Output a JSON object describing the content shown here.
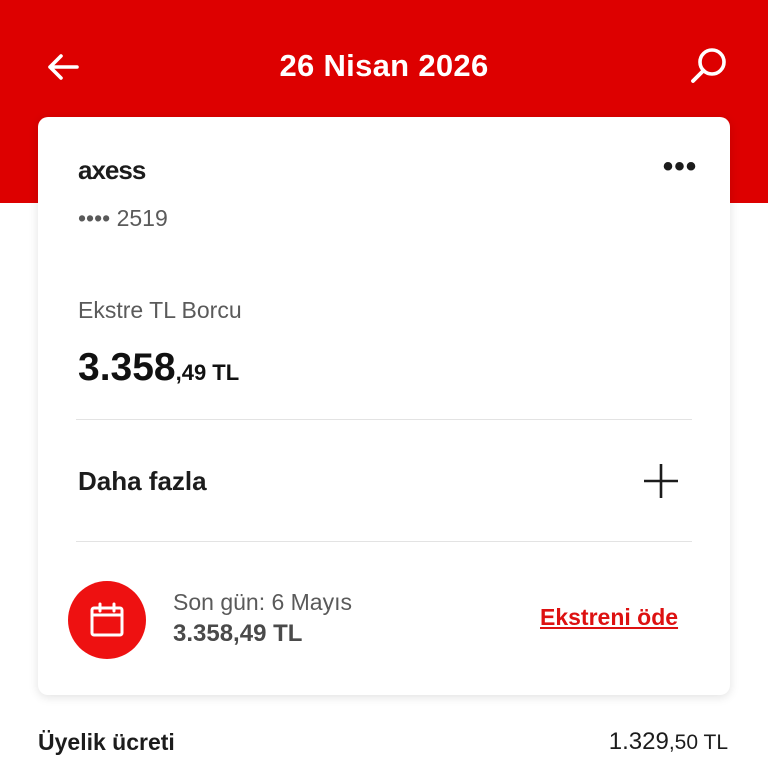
{
  "header": {
    "title": "26 Nisan 2026",
    "back_icon": "arrow-left-icon",
    "search_icon": "search-icon",
    "background_color": "#dd0000"
  },
  "card": {
    "brand": "axess",
    "more_icon": "more-horizontal-icon",
    "more_text": "•••",
    "card_number": "•••• 2519",
    "debt_label": "Ekstre TL Borcu",
    "debt_amount_main": "3.358",
    "debt_amount_fraction": ",49 TL",
    "more_row_label": "Daha fazla",
    "more_row_icon": "plus-icon",
    "due": {
      "icon": "calendar-icon",
      "label": "Son gün: 6 Mayıs",
      "amount": "3.358,49 TL",
      "pay_link": "Ekstreni öde",
      "accent_color": "#dd1111"
    }
  },
  "fee": {
    "label": "Üyelik ücreti",
    "amount_main": "1.329",
    "amount_fraction": ",50 TL"
  }
}
